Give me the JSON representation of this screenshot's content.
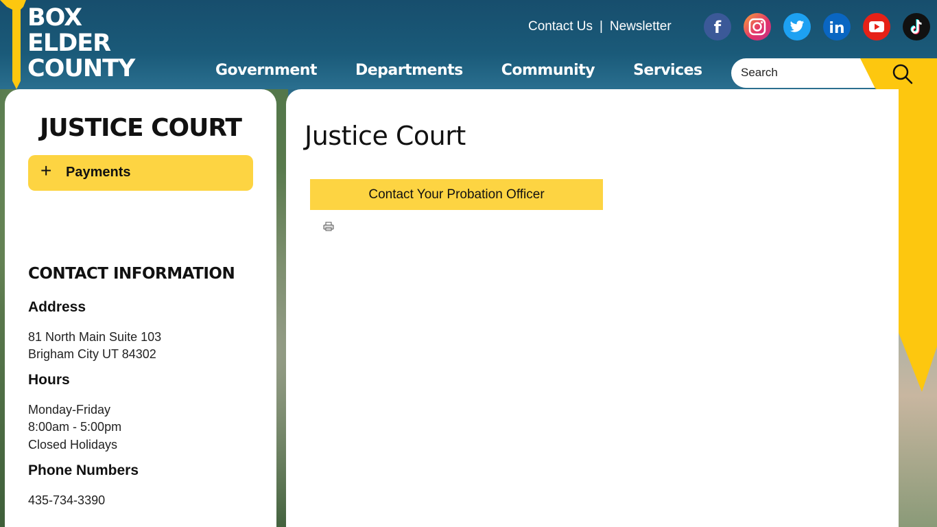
{
  "logo": {
    "line1": "BOX",
    "line2": "ELDER",
    "line3": "COUNTY"
  },
  "top_links": {
    "contact": "Contact Us",
    "separator": "|",
    "newsletter": "Newsletter"
  },
  "social": [
    {
      "name": "facebook-icon",
      "color": "#3b5998"
    },
    {
      "name": "instagram-icon",
      "color": "#e1306c"
    },
    {
      "name": "twitter-icon",
      "color": "#1da1f2"
    },
    {
      "name": "linkedin-icon",
      "color": "#0a66c2"
    },
    {
      "name": "youtube-icon",
      "color": "#e62117"
    },
    {
      "name": "tiktok-icon",
      "color": "#111111"
    }
  ],
  "nav": {
    "government": "Government",
    "departments": "Departments",
    "community": "Community",
    "services": "Services"
  },
  "search": {
    "placeholder": "Search"
  },
  "sidebar": {
    "title": "JUSTICE COURT",
    "payments_label": "Payments",
    "contact_heading": "CONTACT INFORMATION",
    "address_heading": "Address",
    "address_line1": "81 North Main Suite 103",
    "address_line2": "Brigham City UT 84302",
    "hours_heading": "Hours",
    "hours_line1": "Monday-Friday",
    "hours_line2": "8:00am - 5:00pm",
    "hours_line3": "Closed Holidays",
    "phone_heading": "Phone Numbers",
    "phone_line1": "435-734-3390"
  },
  "main": {
    "title": "Justice Court",
    "probation_button": "Contact Your Probation Officer"
  },
  "colors": {
    "accent_yellow": "#fdd442",
    "ribbon_yellow": "#fdc70f",
    "header_blue": "#174e6d"
  }
}
